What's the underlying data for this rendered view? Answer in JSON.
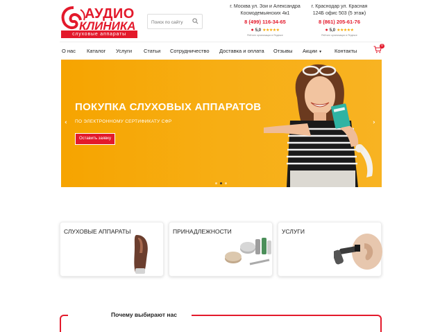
{
  "logo": {
    "word1": "АУДИО",
    "word2": "КЛИНИКА",
    "tagline": "слуховые аппараты"
  },
  "search": {
    "placeholder": "Поиск по сайту"
  },
  "branches": [
    {
      "address": "г. Москва ул. Зои и Александра Космодемьянских 4к1",
      "phone": "8 (499) 116-34-65",
      "rating": "5,0",
      "stars": "★★★★★",
      "note": "Рейтинг организации в Яндексе"
    },
    {
      "address": "г. Краснодар ул. Красная 124Б офис 503 (5 этаж)",
      "phone": "8 (861) 205-61-76",
      "rating": "5,0",
      "stars": "★★★★★",
      "note": "Рейтинг организации в Яндексе"
    }
  ],
  "nav": {
    "items": [
      "О нас",
      "Каталог",
      "Услуги",
      "Статьи",
      "Сотрудничество",
      "Доставка и оплата",
      "Отзывы",
      "Акции",
      "Контакты"
    ],
    "cart_count": "0"
  },
  "hero": {
    "title": "ПОКУПКА СЛУХОВЫХ АППАРАТОВ",
    "subtitle": "ПО ЭЛЕКТРОННОМУ СЕРТИФИКАТУ СФР",
    "button": "Оставить заявку",
    "prev": "‹",
    "next": "›",
    "slides": 3,
    "active_slide": 2
  },
  "categories": [
    {
      "label": "СЛУХОВЫЕ АППАРАТЫ"
    },
    {
      "label": "ПРИНАДЛЕЖНОСТИ"
    },
    {
      "label": "УСЛУГИ"
    }
  ],
  "why": {
    "title": "Почему выбирают нас"
  },
  "colors": {
    "brand": "#e3192b",
    "hero_bg": "#f7ae14"
  }
}
